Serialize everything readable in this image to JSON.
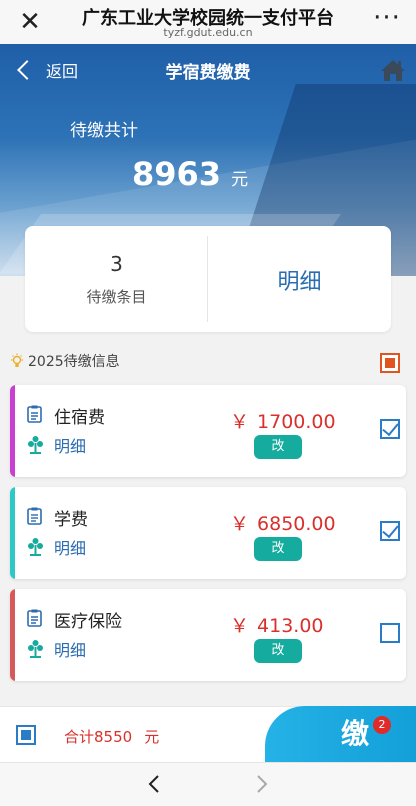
{
  "browser": {
    "title": "广东工业大学校园统一支付平台",
    "url": "tyzf.gdut.edu.cn",
    "close_icon": "close-icon",
    "more_icon": "more-icon"
  },
  "nav": {
    "back_label": "返回",
    "title": "学宿费缴费",
    "home_icon": "home-icon"
  },
  "due": {
    "label": "待缴共计",
    "amount": "8963",
    "unit": "元"
  },
  "summary": {
    "count": "3",
    "count_label": "待缴条目",
    "detail_label": "明细"
  },
  "section": {
    "title": "2025待缴信息",
    "select_all_color": "#e0541f"
  },
  "fees": [
    {
      "name": "住宿费",
      "detail": "明细",
      "currency": "￥",
      "amount": "1700.00",
      "edit": "改",
      "checked": true,
      "stripe_color": "#c93fcf"
    },
    {
      "name": "学费",
      "detail": "明细",
      "currency": "￥",
      "amount": "6850.00",
      "edit": "改",
      "checked": true,
      "stripe_color": "#2ec9c4"
    },
    {
      "name": "医疗保险",
      "detail": "明细",
      "currency": "￥",
      "amount": "413.00",
      "edit": "改",
      "checked": false,
      "stripe_color": "#d65a5a"
    }
  ],
  "footer": {
    "total_label": "合计8550",
    "unit": "元",
    "pay_glyph": "缴",
    "badge": "2"
  },
  "colors": {
    "accent_blue": "#2a6db1",
    "amount_red": "#d9302c",
    "edit_teal": "#15ab9e"
  }
}
